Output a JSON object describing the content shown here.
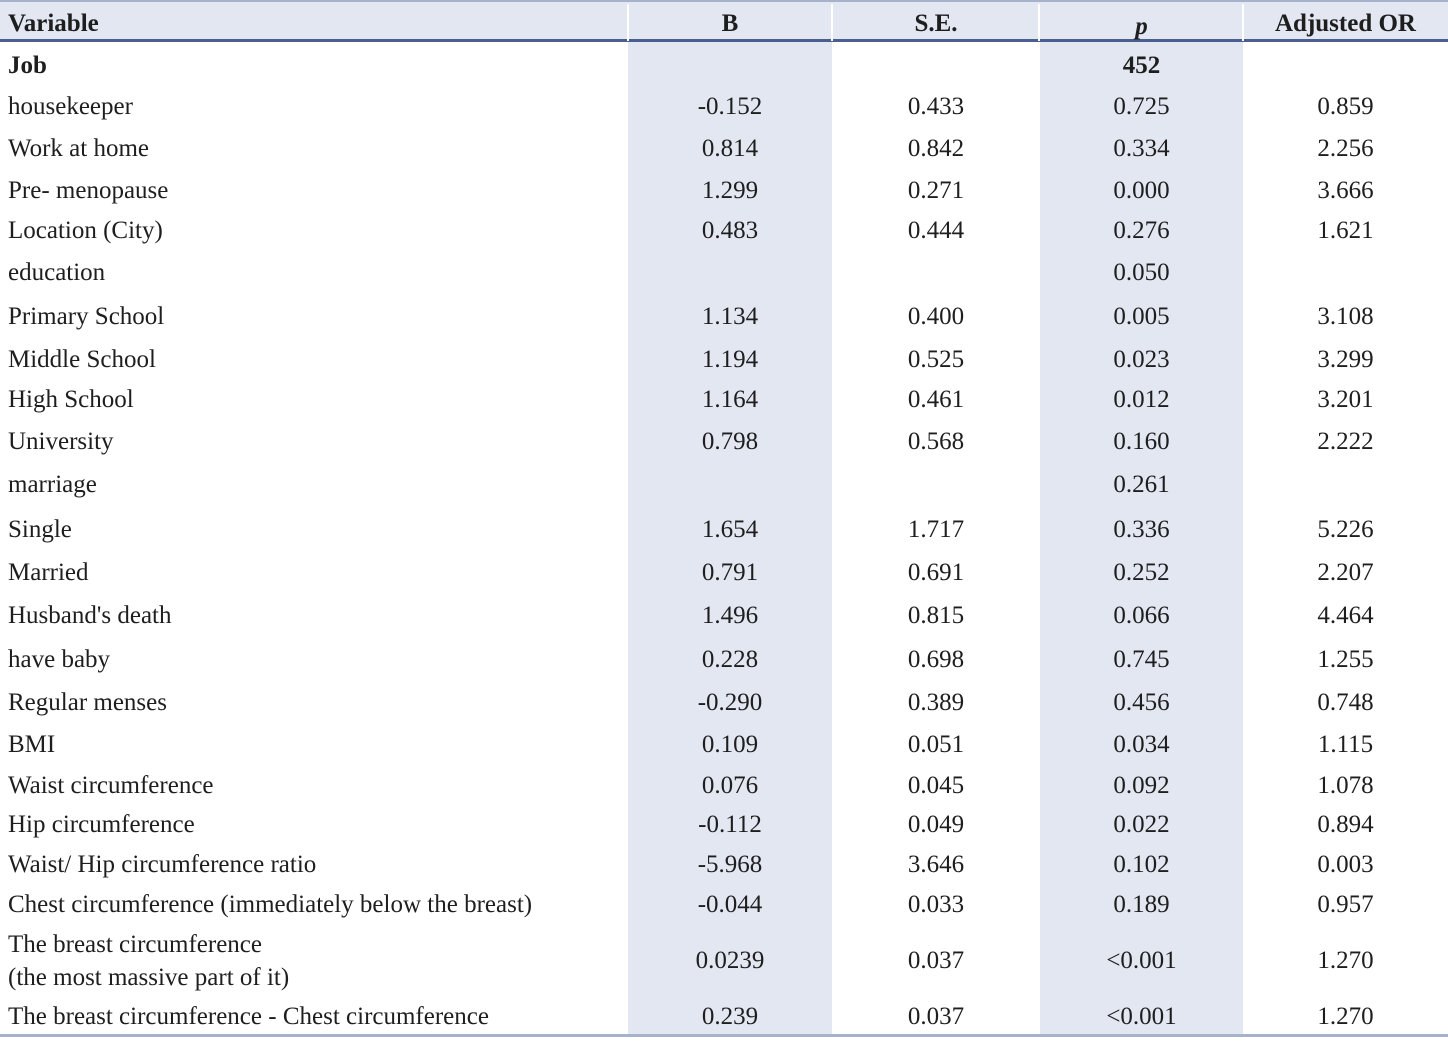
{
  "table": {
    "headers": [
      "Variable",
      "B",
      "S.E.",
      "p",
      "Adjusted OR"
    ],
    "rows": [
      {
        "variable": "Job",
        "b": "",
        "se": "",
        "p": "452",
        "or": "",
        "bold": true
      },
      {
        "variable": "housekeeper",
        "b": "-0.152",
        "se": "0.433",
        "p": "0.725",
        "or": "0.859"
      },
      {
        "variable": "Work at home",
        "b": "0.814",
        "se": "0.842",
        "p": "0.334",
        "or": "2.256"
      },
      {
        "variable": "Pre- menopause",
        "b": "1.299",
        "se": "0.271",
        "p": "0.000",
        "or": "3.666"
      },
      {
        "variable": "Location (City)",
        "b": "0.483",
        "se": "0.444",
        "p": "0.276",
        "or": "1.621"
      },
      {
        "variable": "education",
        "b": "",
        "se": "",
        "p": "0.050",
        "or": ""
      },
      {
        "variable": "Primary School",
        "b": "1.134",
        "se": "0.400",
        "p": "0.005",
        "or": "3.108"
      },
      {
        "variable": "Middle School",
        "b": "1.194",
        "se": "0.525",
        "p": "0.023",
        "or": "3.299"
      },
      {
        "variable": "High School",
        "b": "1.164",
        "se": "0.461",
        "p": "0.012",
        "or": "3.201"
      },
      {
        "variable": "University",
        "b": "0.798",
        "se": "0.568",
        "p": "0.160",
        "or": "2.222"
      },
      {
        "variable": "marriage",
        "b": "",
        "se": "",
        "p": "0.261",
        "or": ""
      },
      {
        "variable": "Single",
        "b": "1.654",
        "se": "1.717",
        "p": "0.336",
        "or": "5.226"
      },
      {
        "variable": "Married",
        "b": "0.791",
        "se": "0.691",
        "p": "0.252",
        "or": "2.207"
      },
      {
        "variable": "Husband's death",
        "b": "1.496",
        "se": "0.815",
        "p": "0.066",
        "or": "4.464"
      },
      {
        "variable": "have baby",
        "b": "0.228",
        "se": "0.698",
        "p": "0.745",
        "or": "1.255"
      },
      {
        "variable": "Regular menses",
        "b": "-0.290",
        "se": "0.389",
        "p": "0.456",
        "or": "0.748"
      },
      {
        "variable": "BMI",
        "b": "0.109",
        "se": "0.051",
        "p": "0.034",
        "or": "1.115"
      },
      {
        "variable": "Waist circumference",
        "b": "0.076",
        "se": "0.045",
        "p": "0.092",
        "or": "1.078"
      },
      {
        "variable": "Hip circumference",
        "b": "-0.112",
        "se": "0.049",
        "p": "0.022",
        "or": "0.894"
      },
      {
        "variable": "Waist/ Hip circumference ratio",
        "b": "-5.968",
        "se": "3.646",
        "p": "0.102",
        "or": "0.003"
      },
      {
        "variable": "Chest circumference (immediately below the breast)",
        "b": "-0.044",
        "se": "0.033",
        "p": "0.189",
        "or": "0.957"
      },
      {
        "variable": "The breast circumference",
        "variable_line2": "(the most massive part of it)",
        "b": "0.0239",
        "se": "0.037",
        "p": "<0.001",
        "or": "1.270"
      },
      {
        "variable": "The breast circumference - Chest circumference",
        "b": "0.239",
        "se": "0.037",
        "p": "<0.001",
        "or": "1.270"
      }
    ]
  }
}
